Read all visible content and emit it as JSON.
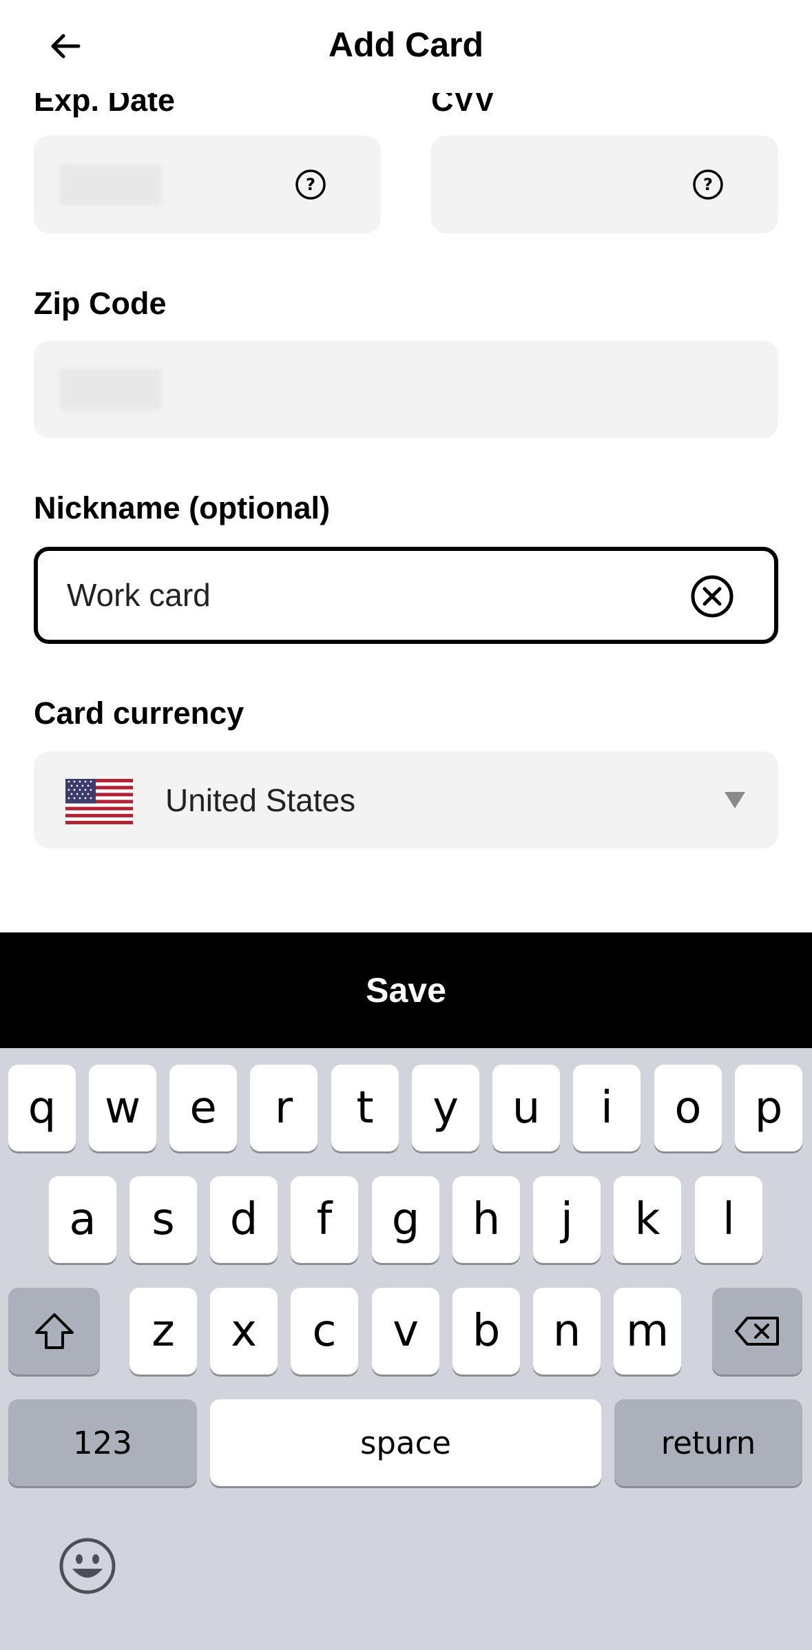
{
  "header": {
    "title": "Add Card",
    "back_icon": "arrow-left-icon"
  },
  "form": {
    "exp_date": {
      "label": "Exp. Date",
      "help_icon": "question-circle-icon"
    },
    "cvv": {
      "label": "CVV",
      "help_icon": "question-circle-icon"
    },
    "zip": {
      "label": "Zip Code"
    },
    "nickname": {
      "label": "Nickname (optional)",
      "value": "Work card",
      "clear_icon": "clear-circle-x-icon"
    },
    "currency": {
      "label": "Card currency",
      "value": "United States",
      "flag_icon": "us-flag-icon",
      "dropdown_icon": "caret-down-icon"
    }
  },
  "save_label": "Save",
  "keyboard": {
    "row1": [
      "q",
      "w",
      "e",
      "r",
      "t",
      "y",
      "u",
      "i",
      "o",
      "p"
    ],
    "row2": [
      "a",
      "s",
      "d",
      "f",
      "g",
      "h",
      "j",
      "k",
      "l"
    ],
    "row3": [
      "z",
      "x",
      "c",
      "v",
      "b",
      "n",
      "m"
    ],
    "shift_icon": "shift-arrow-icon",
    "backspace_icon": "backspace-icon",
    "numbers_label": "123",
    "space_label": "space",
    "return_label": "return",
    "emoji_icon": "emoji-face-icon"
  },
  "colors": {
    "field_bg": "#f3f3f3",
    "keyboard_bg": "#d1d4db",
    "dark_key": "#abb0bb",
    "save_bar": "#000000"
  }
}
